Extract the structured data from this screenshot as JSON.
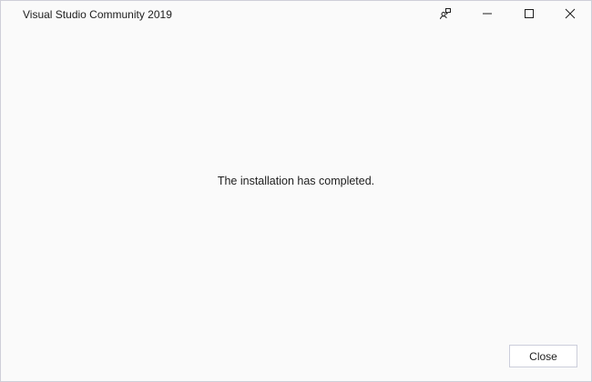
{
  "window": {
    "title": "Visual Studio Community 2019"
  },
  "titlebar_buttons": [
    {
      "name": "feedback",
      "icon": "feedback-icon"
    },
    {
      "name": "minimize",
      "icon": "minimize-icon"
    },
    {
      "name": "maximize",
      "icon": "maximize-icon"
    },
    {
      "name": "close",
      "icon": "close-icon"
    }
  ],
  "main": {
    "message": "The installation has completed."
  },
  "footer": {
    "close_label": "Close"
  },
  "colors": {
    "background": "#fafafa",
    "border": "#cfcfd8",
    "text": "#1e1e1e",
    "button_border": "#cccedb"
  }
}
